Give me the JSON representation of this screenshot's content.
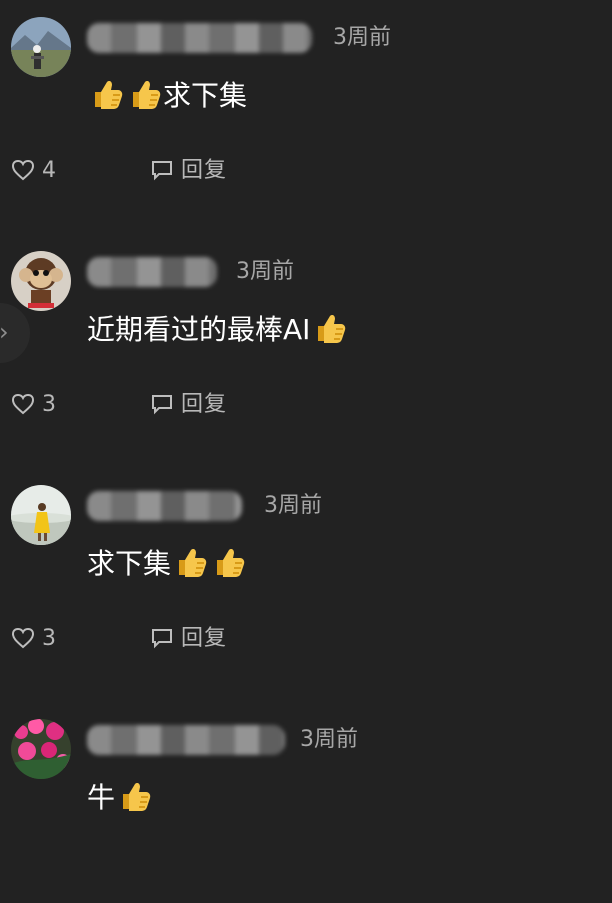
{
  "comments": [
    {
      "time": "3周前",
      "text": "求下集",
      "emoji_before": 2,
      "emoji_after": 0,
      "likes": "4",
      "reply_label": "回复",
      "avatar_icon": "mountain-person-avatar"
    },
    {
      "time": "3周前",
      "text": "近期看过的最棒AI",
      "emoji_before": 0,
      "emoji_after": 1,
      "likes": "3",
      "reply_label": "回复",
      "avatar_icon": "monkey-avatar"
    },
    {
      "time": "3周前",
      "text": "求下集",
      "emoji_before": 0,
      "emoji_after": 2,
      "likes": "3",
      "reply_label": "回复",
      "avatar_icon": "beach-person-avatar"
    },
    {
      "time": "3周前",
      "text": "牛",
      "emoji_before": 0,
      "emoji_after": 1,
      "likes": "",
      "reply_label": "",
      "avatar_icon": "flower-avatar"
    }
  ],
  "nav": {
    "edge_arrow_icon": "chevron-right-icon"
  },
  "colors": {
    "background": "#222222",
    "text": "#ffffff",
    "muted": "#a7a7a7",
    "thumbs_up": "#f6c64b"
  }
}
